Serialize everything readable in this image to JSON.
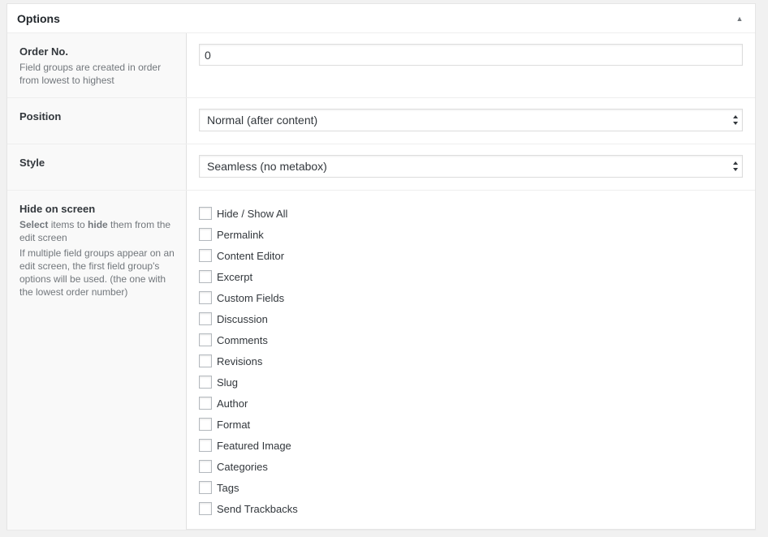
{
  "metabox": {
    "title": "Options"
  },
  "order": {
    "label": "Order No.",
    "description": "Field groups are created in order from lowest to highest",
    "value": "0"
  },
  "position": {
    "label": "Position",
    "selected": "Normal (after content)"
  },
  "style": {
    "label": "Style",
    "selected": "Seamless (no metabox)"
  },
  "hide_on_screen": {
    "label": "Hide on screen",
    "desc_select": "Select",
    "desc_items_to": " items to ",
    "desc_hide": "hide",
    "desc_rest": " them from the edit screen",
    "desc_note": "If multiple field groups appear on an edit screen, the first field group's options will be used. (the one with the lowest order number)",
    "items": [
      {
        "label": "Hide / Show All",
        "checked": false
      },
      {
        "label": "Permalink",
        "checked": false
      },
      {
        "label": "Content Editor",
        "checked": false
      },
      {
        "label": "Excerpt",
        "checked": false
      },
      {
        "label": "Custom Fields",
        "checked": false
      },
      {
        "label": "Discussion",
        "checked": false
      },
      {
        "label": "Comments",
        "checked": false
      },
      {
        "label": "Revisions",
        "checked": false
      },
      {
        "label": "Slug",
        "checked": false
      },
      {
        "label": "Author",
        "checked": false
      },
      {
        "label": "Format",
        "checked": false
      },
      {
        "label": "Featured Image",
        "checked": false
      },
      {
        "label": "Categories",
        "checked": false
      },
      {
        "label": "Tags",
        "checked": false
      },
      {
        "label": "Send Trackbacks",
        "checked": false
      }
    ]
  }
}
